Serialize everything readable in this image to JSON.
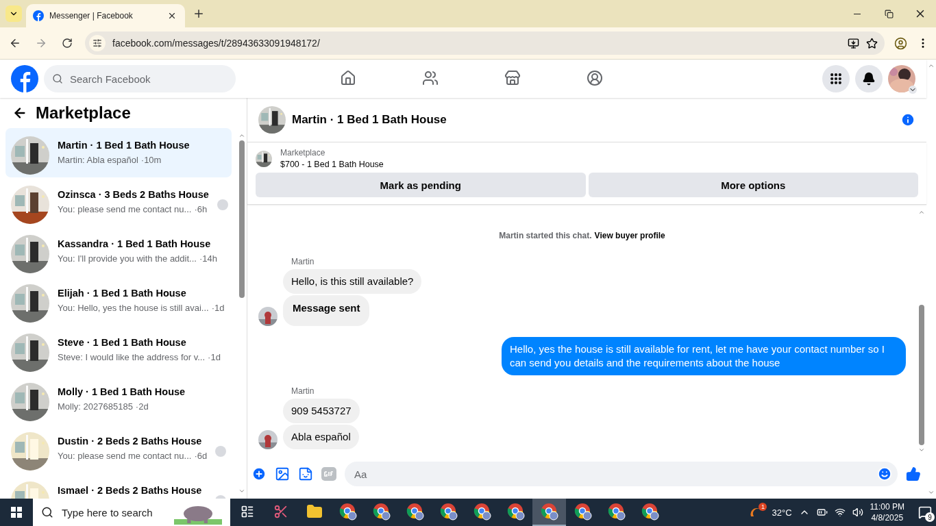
{
  "browser": {
    "tab_title": "Messenger | Facebook",
    "url": "facebook.com/messages/t/28943633091948172/"
  },
  "header": {
    "search_placeholder": "Search Facebook",
    "nav": [
      {
        "kind": "home",
        "selected": false
      },
      {
        "kind": "friends",
        "selected": false
      },
      {
        "kind": "marketplace",
        "selected": false
      },
      {
        "kind": "groups",
        "selected": false
      }
    ]
  },
  "sidebar": {
    "title": "Marketplace",
    "conversations": [
      {
        "title": "Martin · 1 Bed 1 Bath House",
        "preview": "Martin: Abla español",
        "time": "·10m",
        "selected": true,
        "seen": false
      },
      {
        "title": "Ozinsca · 3 Beds 2 Baths House",
        "preview": "You: please send me contact nu...",
        "time": "·6h",
        "selected": false,
        "seen": true
      },
      {
        "title": "Kassandra · 1 Bed 1 Bath House",
        "preview": "You: I'll provide you with the addit...",
        "time": "·14h",
        "selected": false,
        "seen": false
      },
      {
        "title": "Elijah · 1 Bed 1 Bath House",
        "preview": "You: Hello, yes the house is still avai...",
        "time": "·1d",
        "selected": false,
        "seen": false
      },
      {
        "title": "Steve · 1 Bed 1 Bath House",
        "preview": "Steve: I would like the address for v...",
        "time": "·1d",
        "selected": false,
        "seen": false
      },
      {
        "title": "Molly · 1 Bed 1 Bath House",
        "preview": "Molly: 2027685185",
        "time": "·2d",
        "selected": false,
        "seen": false
      },
      {
        "title": "Dustin · 2 Beds 2 Baths House",
        "preview": "You: please send me contact nu...",
        "time": "·6d",
        "selected": false,
        "seen": true
      },
      {
        "title": "Ismael · 2 Beds 2 Baths House",
        "selected": false,
        "seen": true
      }
    ]
  },
  "chat": {
    "title": "Martin · 1 Bed 1 Bath House",
    "listing": {
      "label": "Marketplace",
      "title": "$700 - 1 Bed 1 Bath House"
    },
    "buttons": [
      "Mark as pending",
      "More options"
    ],
    "notice": {
      "text": "Martin started this chat.",
      "link": "View buyer profile"
    },
    "groups": [
      {
        "kind": "incoming",
        "sender": "Martin",
        "messages": [
          {
            "text": "Hello, is this still available?",
            "bold": false
          },
          {
            "text": "Message sent",
            "bold": true
          }
        ]
      },
      {
        "kind": "outgoing",
        "messages": [
          {
            "text": "Hello, yes the house is still available for rent, let me have your contact number so I can send you details and the requirements about the house",
            "bold": false
          }
        ]
      },
      {
        "kind": "incoming",
        "sender": "Martin",
        "messages": [
          {
            "text": "909 5453727",
            "bold": false
          },
          {
            "text": "Abla español",
            "bold": false
          }
        ]
      }
    ],
    "composer_placeholder": "Aa"
  },
  "taskbar": {
    "search_placeholder": "Type here to search",
    "apps": [
      {
        "kind": "taskview",
        "active": false
      },
      {
        "kind": "snip",
        "active": false
      },
      {
        "kind": "folder",
        "active": false
      },
      {
        "kind": "chrome",
        "active": false
      },
      {
        "kind": "chrome",
        "active": false
      },
      {
        "kind": "chrome",
        "active": false
      },
      {
        "kind": "chrome",
        "active": false
      },
      {
        "kind": "chrome",
        "active": false
      },
      {
        "kind": "chrome",
        "active": false
      },
      {
        "kind": "chrome",
        "active": true
      },
      {
        "kind": "chrome",
        "active": false
      },
      {
        "kind": "chrome",
        "active": false
      },
      {
        "kind": "chrome",
        "active": false
      }
    ],
    "weather_badge": "1",
    "temperature": "32°C",
    "time": "11:00 PM",
    "date": "4/8/2025",
    "notifications": "9"
  }
}
